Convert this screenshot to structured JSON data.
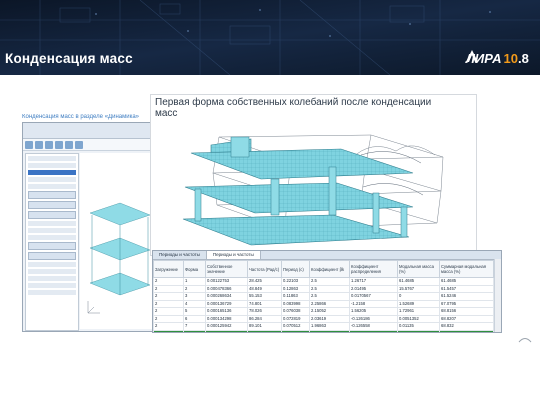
{
  "header": {
    "title": "Конденсация масс",
    "logo_text": "ЛИРА",
    "logo_ver_a": "10",
    "logo_ver_b": ".8"
  },
  "caption_behind": "Конденсация масс в разделе «Динамика»",
  "card": {
    "title": "Первая форма собственных колебаний после конденсации масс"
  },
  "table_window": {
    "tabs": [
      "Периоды и частоты",
      "Периоды и частоты"
    ],
    "columns": [
      "Загружение",
      "Форма",
      "Собственное значение",
      "Частота (Рад/с)",
      "Период (с)",
      "Коэффициент βk",
      "Коэффициент распределения",
      "Модальная масса (%)",
      "Суммарная модальная масса (%)"
    ],
    "rows": [
      [
        "2",
        "1",
        "0.00122753",
        "28.425",
        "0.22103",
        "2.5",
        "1.26717",
        "61.4685",
        "61.4685"
      ],
      [
        "2",
        "2",
        "0.000478366",
        "48.849",
        "0.12863",
        "2.5",
        "2.01495",
        "15.5767",
        "61.5457"
      ],
      [
        "2",
        "3",
        "0.000268634",
        "55.153",
        "0.11863",
        "2.5",
        "0.0170567",
        "0",
        "61.5246"
      ],
      [
        "2",
        "4",
        "0.000136729",
        "74.801",
        "0.083998",
        "2.25866",
        "-1.2158",
        "1.52689",
        "67.0795"
      ],
      [
        "2",
        "5",
        "0.000165136",
        "78.026",
        "0.076038",
        "2.15052",
        "1.56205",
        "1.72961",
        "68.8156"
      ],
      [
        "2",
        "6",
        "0.000134298",
        "86.284",
        "0.072819",
        "2.03619",
        "-0.126186",
        "0.0051352",
        "68.8207"
      ],
      [
        "2",
        "7",
        "0.000125942",
        "89.101",
        "0.070512",
        "1.96863",
        "-0.126558",
        "0.01135",
        "68.832"
      ],
      [
        "2",
        "8",
        "0.000119443",
        "91.684",
        "0.068391",
        "2.02572",
        "-0.0271486",
        "0",
        "68.839"
      ]
    ],
    "selected_row_index": 7
  },
  "colors": {
    "banner": "#0e1a2e",
    "model_fill": "#7fd3e0",
    "selected_row": "#2f8f3e",
    "logo_accent": "#f29a1a"
  }
}
